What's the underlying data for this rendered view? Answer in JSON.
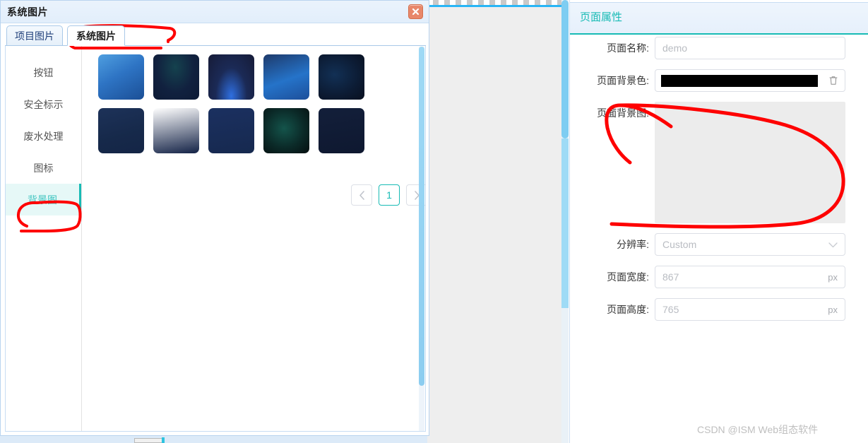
{
  "dialog": {
    "title": "系统图片",
    "close_icon": "close-icon",
    "tabs": [
      {
        "label": "项目图片",
        "active": false
      },
      {
        "label": "系统图片",
        "active": true
      }
    ],
    "sidebar": {
      "items": [
        {
          "label": "按钮",
          "selected": false
        },
        {
          "label": "安全标示",
          "selected": false
        },
        {
          "label": "废水处理",
          "selected": false
        },
        {
          "label": "图标",
          "selected": false
        },
        {
          "label": "背景图",
          "selected": true
        }
      ]
    },
    "thumbnails": [
      {
        "name": "world-map-blue",
        "css": "linear-gradient(150deg,#4f9fe0 0%,#2e74c4 45%,#1b4f96 100%)"
      },
      {
        "name": "dark-teal-glow",
        "css": "radial-gradient(ellipse at 48% 28%, #15424e 0%, #11213f 55%, #0d1a35 100%)"
      },
      {
        "name": "blue-arc-night",
        "css": "radial-gradient(ellipse at 50% 92%, #2f6fe0 0%, #1b2a56 48%, #161b37 100%)"
      },
      {
        "name": "blue-gradient-plain",
        "css": "linear-gradient(160deg,#1e3a6b 0%,#2573c9 55%,#1d4f9a 100%)"
      },
      {
        "name": "circuit-dark-blue",
        "css": "radial-gradient(ellipse at 35% 45%, #123055 0%, #0c1b33 60%, #08101f 100%)"
      },
      {
        "name": "deep-navy-plain",
        "css": "linear-gradient(165deg,#1d3259 0%,#16294a 60%,#142546 100%)"
      },
      {
        "name": "navy-flat",
        "css": "linear-gradient(170deg,#16264a 0%,#12204000 0%,#132246 100%)"
      },
      {
        "name": "world-map-navy",
        "css": "linear-gradient(170deg,#1b3060 0%,#16294f 100%)"
      },
      {
        "name": "green-nebula",
        "css": "radial-gradient(ellipse at 45% 45%, #14544b 0%, #0b2a28 55%, #050f10 100%)"
      },
      {
        "name": "starfield-dark",
        "css": "linear-gradient(170deg,#131f3a 0%,#0e1830 100%)"
      }
    ],
    "pagination": {
      "prev_icon": "chevron-left-icon",
      "next_icon": "chevron-right-icon",
      "pages": [
        "1"
      ],
      "current": "1"
    }
  },
  "right_panel": {
    "tab_label": "页面属性",
    "accent": "#18bbb5",
    "fields": [
      {
        "label": "页面名称:",
        "type": "text",
        "value": "demo"
      },
      {
        "label": "页面背景色:",
        "type": "color",
        "value": "#000000",
        "delete_icon": "trash-icon"
      },
      {
        "label": "页面背景图:",
        "type": "image",
        "value": ""
      },
      {
        "label": "分辨率:",
        "type": "select",
        "value": "Custom",
        "chevron": "chevron-down-icon"
      },
      {
        "label": "页面宽度:",
        "type": "number",
        "value": "867",
        "unit": "px"
      },
      {
        "label": "页面高度:",
        "type": "number",
        "value": "765",
        "unit": "px"
      }
    ]
  },
  "watermark": {
    "text": "CSDN @ISM Web组态软件"
  },
  "annotations": {
    "color": "#fe0000",
    "items": [
      {
        "name": "annotation-tab-system-images",
        "shape": "scribble-oval"
      },
      {
        "name": "annotation-sidebar-background-image",
        "shape": "scribble-oval"
      },
      {
        "name": "annotation-background-image-dropzone",
        "shape": "scribble-oval"
      }
    ]
  }
}
